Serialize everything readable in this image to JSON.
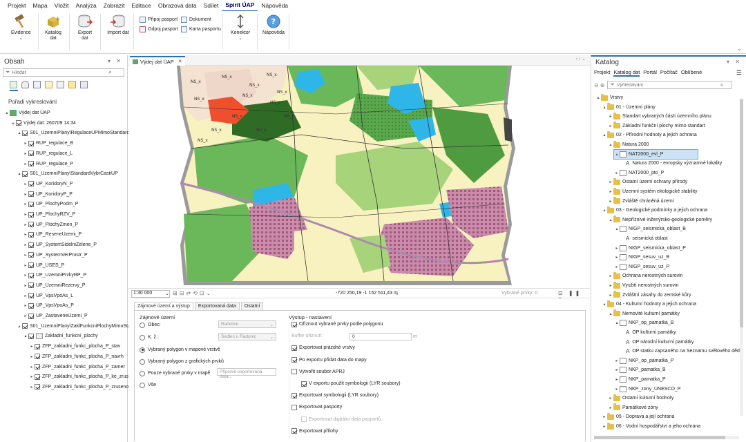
{
  "menu": [
    "Projekt",
    "Mapa",
    "Vložit",
    "Analýza",
    "Zobrazit",
    "Editace",
    "Obrazová data",
    "Sdílet",
    "Spirit ÚAP",
    "Nápověda"
  ],
  "menu_active_index": 8,
  "ribbon": {
    "evidence": "Evidence",
    "katalog": "Katalog dat",
    "export": "Export dat",
    "import": "Import dat",
    "pripoj": "Připoj pasport",
    "odpoj": "Odpoj pasport",
    "dokument": "Dokument",
    "karta": "Karta pasportu",
    "konektor": "Konektor",
    "napoveda": "Nápověda"
  },
  "contents": {
    "title": "Obsah",
    "search_placeholder": "Hledat",
    "drawing_order": "Pořadí vykreslování",
    "rows": [
      {
        "label": "Výdej dat ÚAP",
        "indent": 0,
        "type": "map"
      },
      {
        "label": "Výdej dat: 260709 14:34",
        "indent": 1,
        "type": "group"
      },
      {
        "label": "S01_UzemniPlany\\RegulaceUPMimoStandard",
        "indent": 2,
        "type": "group"
      },
      {
        "label": "RUP_regulace_B",
        "indent": 3,
        "type": "layer"
      },
      {
        "label": "RUP_regulace_L",
        "indent": 3,
        "type": "layer"
      },
      {
        "label": "RUP_regulace_P",
        "indent": 3,
        "type": "layer"
      },
      {
        "label": "S01_UzemniPlany\\StandardVybrCastiUP",
        "indent": 2,
        "type": "group"
      },
      {
        "label": "UP_KoridoryN_P",
        "indent": 3,
        "type": "layer"
      },
      {
        "label": "UP_KoridoryP_P",
        "indent": 3,
        "type": "layer"
      },
      {
        "label": "UP_PlochyPodm_P",
        "indent": 3,
        "type": "layer"
      },
      {
        "label": "UP_PlochyRZV_P",
        "indent": 3,
        "type": "layer"
      },
      {
        "label": "UP_PlochyZmen_P",
        "indent": 3,
        "type": "layer"
      },
      {
        "label": "UP_ReseneUzemi_P",
        "indent": 3,
        "type": "layer"
      },
      {
        "label": "UP_SystemSidelniZelene_P",
        "indent": 3,
        "type": "layer"
      },
      {
        "label": "UP_SystemVerProstr_P",
        "indent": 3,
        "type": "layer"
      },
      {
        "label": "UP_USES_P",
        "indent": 3,
        "type": "layer"
      },
      {
        "label": "UP_UzemniPrvkyRP_P",
        "indent": 3,
        "type": "layer"
      },
      {
        "label": "UP_UzemniRezervy_P",
        "indent": 3,
        "type": "layer"
      },
      {
        "label": "UP_VpsVpoAs_L",
        "indent": 3,
        "type": "layer"
      },
      {
        "label": "UP_VpsVpoAs_P",
        "indent": 3,
        "type": "layer"
      },
      {
        "label": "UP_ZastaveneUzemi_P",
        "indent": 3,
        "type": "layer"
      },
      {
        "label": "S01_UzemniPlany\\ZaklFunkcniPlochyMimoSta...",
        "indent": 2,
        "type": "group"
      },
      {
        "label": "Zakladni_funkcni_plochy",
        "indent": 3,
        "type": "group"
      },
      {
        "label": "ZFP_zakladni_funkc_plocha_P_stav",
        "indent": 4,
        "type": "layer"
      },
      {
        "label": "ZFP_zakladni_funkc_plocha_P_navrh",
        "indent": 4,
        "type": "layer"
      },
      {
        "label": "ZFP_zakladni_funkc_plocha_P_zamer",
        "indent": 4,
        "type": "layer"
      },
      {
        "label": "ZFP_zakladni_funkc_plocha_P_ke_zruseni",
        "indent": 4,
        "type": "layer"
      },
      {
        "label": "ZFP_zakladni_funkc_plocha_P_zruseno",
        "indent": 4,
        "type": "layer"
      }
    ]
  },
  "map": {
    "tab_title": "Výdej dat ÚAP",
    "scale": "1:30 000",
    "coords": "-720 250,19 -1 152 511,43 m",
    "selected": "Vybrané prvky: 0",
    "labels": [
      "NS_x",
      "NS_x",
      "NS_x",
      "NS_x",
      "NS_x",
      "NS_x",
      "NS_x",
      "NS_x",
      "NS_x",
      "NS_x",
      "NS_x",
      "NS_x",
      "NS_x"
    ]
  },
  "tool": {
    "tabs": [
      "Zájmové území a výstup",
      "Exportovaná data",
      "Ostatní"
    ],
    "area_title": "Zájmové území",
    "opts": [
      "Obec:",
      "K. ž.:",
      "Vybraný polygon v mapové vrstvě",
      "Vybraný polygon z grafických prvků",
      "Pouze vybrané prvky v mapě",
      "Vše"
    ],
    "selected_opt": 2,
    "obec_value": "Račetice",
    "kz_value": "Sedlec u Radonic",
    "prepare_placeholder": "Připravit exportovaná data...",
    "out_title": "Výstup - nastavení",
    "out_opts": [
      {
        "label": "Ořiznout vybrané prvky podle polygonu",
        "checked": true,
        "indent": 0,
        "enabled": true
      },
      {
        "label": "Buffer ořiznutí:",
        "checked": null,
        "indent": 0,
        "enabled": false
      },
      {
        "label": "Exportovat prázdné vrstvy",
        "checked": true,
        "indent": 0,
        "enabled": true
      },
      {
        "label": "Po exportu přidat data do mapy",
        "checked": true,
        "indent": 0,
        "enabled": true
      },
      {
        "label": "Vytvořit soubor APRJ",
        "checked": false,
        "indent": 0,
        "enabled": true
      },
      {
        "label": "V exportu použít symbologii (LYR soubory)",
        "checked": true,
        "indent": 1,
        "enabled": true
      },
      {
        "label": "Exportovat symbologii (LYR soubory)",
        "checked": true,
        "indent": 0,
        "enabled": true
      },
      {
        "label": "Exportovat pasporty",
        "checked": false,
        "indent": 0,
        "enabled": true
      },
      {
        "label": "Exportovat digitální data pasportů",
        "checked": false,
        "indent": 1,
        "enabled": false
      },
      {
        "label": "Exportovat přílohy",
        "checked": true,
        "indent": 0,
        "enabled": true
      }
    ],
    "buffer_value": "0",
    "buffer_unit": "m"
  },
  "catalog": {
    "title": "Katalog",
    "tabs": [
      "Projekt",
      "Katalog dat",
      "Portál",
      "Počítač",
      "Oblíbené"
    ],
    "active_tab": 1,
    "search_placeholder": "Vyhledávání",
    "rows": [
      {
        "label": "Vrstvy",
        "indent": 0,
        "type": "folder",
        "tw": "▴"
      },
      {
        "label": "01 - Územní plány",
        "indent": 1,
        "type": "folder",
        "tw": "▴"
      },
      {
        "label": "Standart vybraných částí územního plánu",
        "indent": 2,
        "type": "folder",
        "tw": "▸"
      },
      {
        "label": "Základní funkční plochy mimo standart",
        "indent": 2,
        "type": "folder",
        "tw": "▸"
      },
      {
        "label": "02 - Přírodní hodnoty a jejich ochrana",
        "indent": 1,
        "type": "folder",
        "tw": "▴"
      },
      {
        "label": "Natura 2000",
        "indent": 2,
        "type": "folder",
        "tw": "▴"
      },
      {
        "label": "NAT2000_evl_P",
        "indent": 3,
        "type": "layer",
        "tw": "▴",
        "selected": true
      },
      {
        "label": "Natura 2000 - evropsky významné lokality",
        "indent": 4,
        "type": "sym",
        "tw": ""
      },
      {
        "label": "NAT2000_pto_P",
        "indent": 3,
        "type": "layer",
        "tw": "▸"
      },
      {
        "label": "Ostatní území ochrany přírody",
        "indent": 2,
        "type": "folder",
        "tw": "▸"
      },
      {
        "label": "Územní systém ekologické stability",
        "indent": 2,
        "type": "folder",
        "tw": "▸"
      },
      {
        "label": "Zvláště chráněná území",
        "indent": 2,
        "type": "folder",
        "tw": "▸"
      },
      {
        "label": "03 - Geologické podmínky a jejich ochrana",
        "indent": 1,
        "type": "folder",
        "tw": "▴"
      },
      {
        "label": "Nepříznivé inženýrsko-geologické poměry",
        "indent": 2,
        "type": "folder",
        "tw": "▴"
      },
      {
        "label": "NIGP_seismicka_oblast_B",
        "indent": 3,
        "type": "layer",
        "tw": "▴"
      },
      {
        "label": "seismická oblast",
        "indent": 4,
        "type": "sym",
        "tw": ""
      },
      {
        "label": "NIGP_seismicka_oblast_P",
        "indent": 3,
        "type": "layer",
        "tw": "▸"
      },
      {
        "label": "NIGP_sesuv_uz_B",
        "indent": 3,
        "type": "layer",
        "tw": "▸"
      },
      {
        "label": "NIGP_sesuv_uz_P",
        "indent": 3,
        "type": "layer",
        "tw": "▸"
      },
      {
        "label": "Ochrana nerostných surovin",
        "indent": 2,
        "type": "folder",
        "tw": "▸"
      },
      {
        "label": "Využití nerostných surovin",
        "indent": 2,
        "type": "folder",
        "tw": "▸"
      },
      {
        "label": "Zvláštní zásahy do zemské kůry",
        "indent": 2,
        "type": "folder",
        "tw": "▸"
      },
      {
        "label": "04 - Kulturní hodnoty a jejich ochrana",
        "indent": 1,
        "type": "folder",
        "tw": "▴"
      },
      {
        "label": "Nemovité kulturní památky",
        "indent": 2,
        "type": "folder",
        "tw": "▴"
      },
      {
        "label": "NKP_op_pamatka_B",
        "indent": 3,
        "type": "layer",
        "tw": "▴"
      },
      {
        "label": "OP kulturní památky",
        "indent": 4,
        "type": "sym",
        "tw": ""
      },
      {
        "label": "OP národní kulturní památky",
        "indent": 4,
        "type": "sym",
        "tw": ""
      },
      {
        "label": "OP statku zapsaného na Seznamu světového děd",
        "indent": 4,
        "type": "sym",
        "tw": ""
      },
      {
        "label": "NKP_op_pamatka_P",
        "indent": 3,
        "type": "layer",
        "tw": "▸"
      },
      {
        "label": "NKP_pamatka_B",
        "indent": 3,
        "type": "layer",
        "tw": "▸"
      },
      {
        "label": "NKP_pamatka_P",
        "indent": 3,
        "type": "layer",
        "tw": "▸"
      },
      {
        "label": "NKP_zony_UNESCO_P",
        "indent": 3,
        "type": "layer",
        "tw": "▸"
      },
      {
        "label": "Ostatní kulturní hodnoty",
        "indent": 2,
        "type": "folder",
        "tw": "▸"
      },
      {
        "label": "Památkové zóny",
        "indent": 2,
        "type": "folder",
        "tw": "▸"
      },
      {
        "label": "05 - Doprava a její ochrana",
        "indent": 1,
        "type": "folder",
        "tw": "▸"
      },
      {
        "label": "06 - Vodní hospodářství a jeho ochrana",
        "indent": 1,
        "type": "folder",
        "tw": "▸"
      }
    ]
  }
}
